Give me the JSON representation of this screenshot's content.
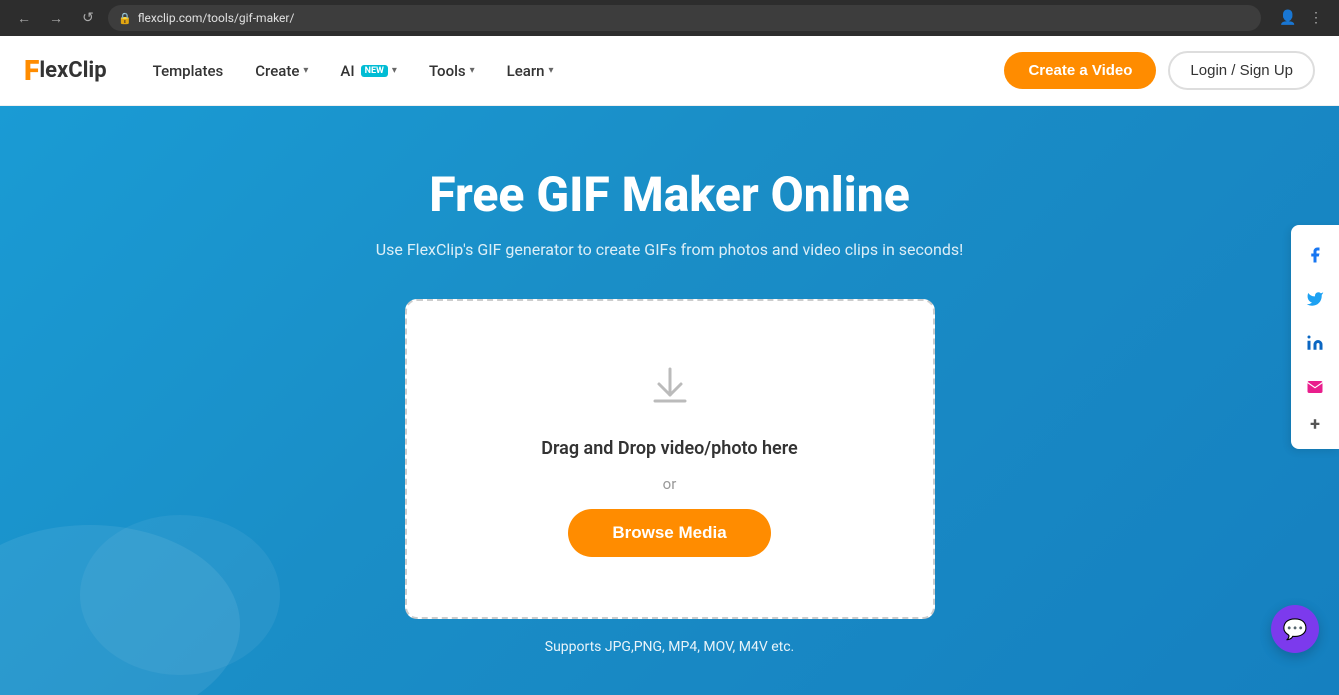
{
  "browser": {
    "url": "flexclip.com/tools/gif-maker/",
    "back_label": "←",
    "forward_label": "→",
    "reload_label": "↺"
  },
  "navbar": {
    "logo_f": "F",
    "logo_text": "lexClip",
    "nav_items": [
      {
        "id": "templates",
        "label": "Templates",
        "has_chevron": false
      },
      {
        "id": "create",
        "label": "Create",
        "has_chevron": true
      },
      {
        "id": "ai",
        "label": "AI",
        "has_chevron": true,
        "badge": "NEW"
      },
      {
        "id": "tools",
        "label": "Tools",
        "has_chevron": true
      },
      {
        "id": "learn",
        "label": "Learn",
        "has_chevron": true
      }
    ],
    "create_btn": "Create a Video",
    "login_btn": "Login / Sign Up"
  },
  "hero": {
    "title": "Free GIF Maker Online",
    "subtitle": "Use FlexClip's GIF generator to create GIFs from photos and video clips in seconds!",
    "upload_text": "Drag and Drop video/photo here",
    "upload_or": "or",
    "browse_btn": "Browse Media",
    "supports_text": "Supports JPG,PNG, MP4, MOV, M4V etc."
  },
  "social": {
    "facebook_label": "f",
    "twitter_label": "𝕏",
    "linkedin_label": "in",
    "email_label": "✉",
    "more_label": "+"
  },
  "chat": {
    "icon": "💬"
  }
}
